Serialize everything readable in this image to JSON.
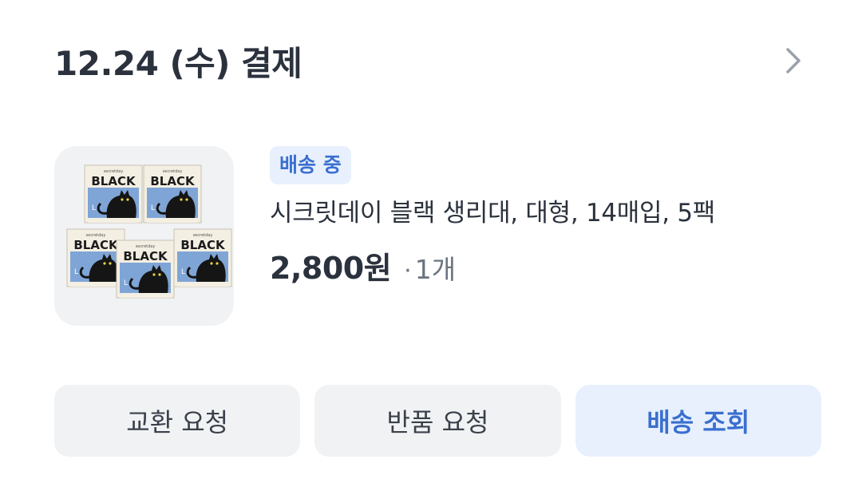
{
  "header": {
    "order_date_label": "12.24 (수) 결제",
    "chevron_icon": "chevron-right-icon"
  },
  "product": {
    "image_alt": "secretday BLACK pads box",
    "status_badge": "배송 중",
    "name": "시크릿데이 블랙 생리대, 대형, 14매입, 5팩",
    "price": "2,800원",
    "quantity": "1개",
    "package_brand_small": "secretday",
    "package_brand_big": "BLACK"
  },
  "actions": {
    "exchange_label": "교환 요청",
    "return_label": "반품 요청",
    "tracking_label": "배송 조회"
  },
  "colors": {
    "accent": "#3a6fcf",
    "accent_bg": "#e8f0fd",
    "button_bg": "#f1f2f4",
    "text_primary": "#2b323d",
    "text_secondary": "#6b7480"
  }
}
